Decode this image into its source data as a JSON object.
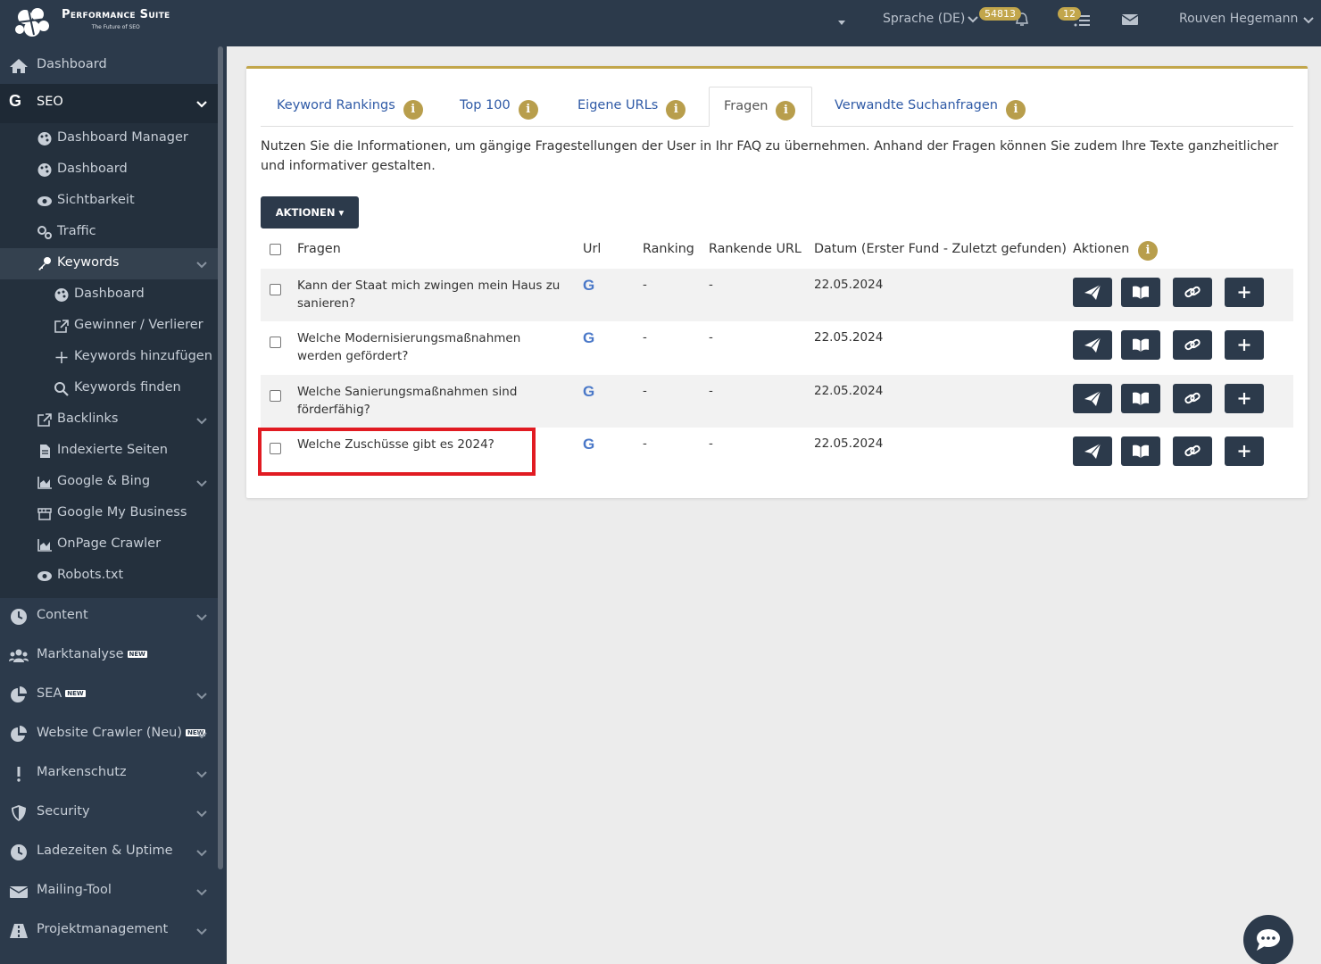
{
  "app": {
    "brand_title": "Performance Suite",
    "brand_sub": "The Future of SEO"
  },
  "topbar": {
    "language": "Sprache (DE)",
    "notif_badge": "54813",
    "tasks_badge": "12",
    "user_name": "Rouven Hegemann"
  },
  "sidebar": {
    "dashboard": "Dashboard",
    "seo": "SEO",
    "seo_items": {
      "dashboard_manager": "Dashboard Manager",
      "dashboard": "Dashboard",
      "sichtbarkeit": "Sichtbarkeit",
      "traffic": "Traffic",
      "keywords": "Keywords",
      "kw_dashboard": "Dashboard",
      "gewinner": "Gewinner / Verlierer",
      "hinzufuegen": "Keywords hinzufügen",
      "finden": "Keywords finden",
      "backlinks": "Backlinks",
      "indexierte": "Indexierte Seiten",
      "google_bing": "Google & Bing",
      "gmb": "Google My Business",
      "onpage": "OnPage Crawler",
      "robots": "Robots.txt"
    },
    "content": "Content",
    "marktanalyse": "Marktanalyse",
    "sea": "SEA",
    "website_crawler": "Website Crawler (Neu)",
    "markenschutz": "Markenschutz",
    "security": "Security",
    "ladezeiten": "Ladezeiten & Uptime",
    "mailing": "Mailing-Tool",
    "projekt": "Projektmanagement",
    "new_tag": "NEW"
  },
  "tabs": {
    "keyword_rankings": "Keyword Rankings",
    "top100": "Top 100",
    "eigene_urls": "Eigene URLs",
    "fragen": "Fragen",
    "verwandte": "Verwandte Suchanfragen",
    "info_glyph": "i"
  },
  "description": "Nutzen Sie die Informationen, um gängige Fragestellungen der User in Ihr FAQ zu übernehmen. Anhand der Fragen können Sie zudem Ihre Texte ganzheitlicher und informativer gestalten.",
  "actions_button": "AKTIONEN ▾",
  "table": {
    "headers": {
      "fragen": "Fragen",
      "url": "Url",
      "ranking": "Ranking",
      "rankende_url": "Rankende URL",
      "datum": "Datum (Erster Fund - Zuletzt gefunden)",
      "aktionen": "Aktionen"
    },
    "rows": [
      {
        "question": "Kann der Staat mich zwingen mein Haus zu sanieren?",
        "url": "G",
        "ranking": "-",
        "rankende_url": "-",
        "date": "22.05.2024"
      },
      {
        "question": "Welche Modernisierungsmaßnahmen werden gefördert?",
        "url": "G",
        "ranking": "-",
        "rankende_url": "-",
        "date": "22.05.2024"
      },
      {
        "question": "Welche Sanierungsmaßnahmen sind förderfähig?",
        "url": "G",
        "ranking": "-",
        "rankende_url": "-",
        "date": "22.05.2024"
      },
      {
        "question": "Welche Zuschüsse gibt es 2024?",
        "url": "G",
        "ranking": "-",
        "rankende_url": "-",
        "date": "22.05.2024"
      }
    ]
  },
  "colors": {
    "sidebar_bg": "#2c3a4b",
    "accent_gold": "#c2a64b",
    "link_blue": "#2f5aa6",
    "highlight_red": "#e11b22"
  }
}
